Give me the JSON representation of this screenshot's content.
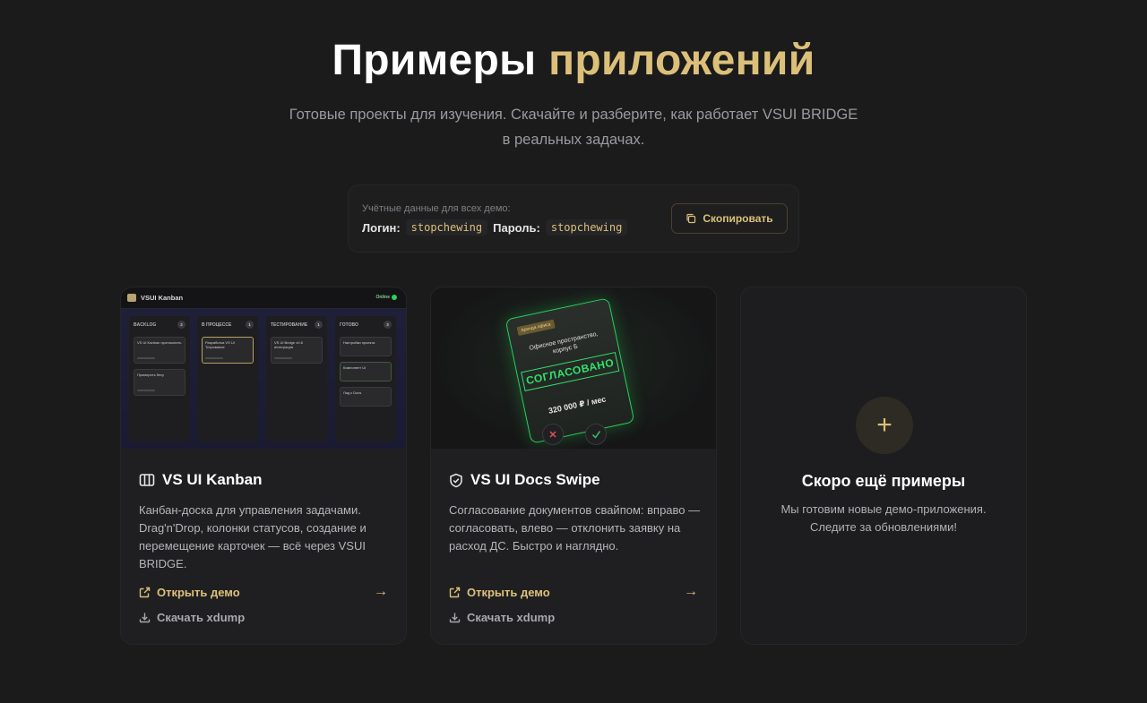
{
  "header": {
    "title_main": "Примеры",
    "title_accent": "приложений",
    "subtitle_line1": "Готовые проекты для изучения. Скачайте и разберите, как работает VSUI BRIDGE",
    "subtitle_line2": "в реальных задачах."
  },
  "credentials": {
    "hint": "Учётные данные для всех демо:",
    "login_label": "Логин:",
    "login_value": "stopchewing",
    "password_label": "Пароль:",
    "password_value": "stopchewing",
    "copy_label": "Скопировать",
    "copy_icon": "copy-icon"
  },
  "cards": [
    {
      "title": "VS UI Kanban",
      "icon": "columns-icon",
      "description": "Канбан-доска для управления задачами. Drag'n'Drop, колонки статусов, создание и перемещение карточек — всё через VSUI BRIDGE.",
      "open_label": "Открыть демо",
      "download_label": "Скачать xdump",
      "preview": {
        "app_title": "VSUI Kanban",
        "status": "Online",
        "columns": [
          {
            "name": "BACKLOG",
            "count": "2",
            "cards": [
              "VS UI Kanban протоколить",
              "Примерить flexy"
            ]
          },
          {
            "name": "В ПРОЦЕССЕ",
            "count": "1",
            "cards": [
              "Разработка VS UI Титрование"
            ]
          },
          {
            "name": "ТЕСТИРОВАНИЕ",
            "count": "1",
            "cards": [
              "VS UI Bridge v0.8 интеграция"
            ]
          },
          {
            "name": "ГОТОВО",
            "count": "3",
            "cards": [
              "Настройки проекта",
              "Компонент UI",
              "Лид к Docs"
            ]
          }
        ]
      }
    },
    {
      "title": "VS UI Docs Swipe",
      "icon": "shield-check-icon",
      "description": "Согласование документов свайпом: вправо — согласовать, влево — отклонить заявку на расход ДС. Быстро и наглядно.",
      "open_label": "Открыть демо",
      "download_label": "Скачать xdump",
      "preview": {
        "tag": "Аренда офиса",
        "doc_title": "Офисное пространство, корпус Б",
        "stamp": "СОГЛАСОВАНО",
        "price": "320 000 ₽ / мес"
      }
    }
  ],
  "coming_soon": {
    "title": "Скоро ещё примеры",
    "description_line1": "Мы готовим новые демо-приложения.",
    "description_line2": "Следите за обновлениями!"
  },
  "colors": {
    "background": "#1b1b1c",
    "accent": "#dcc07a",
    "approve_green": "#31e26a"
  }
}
